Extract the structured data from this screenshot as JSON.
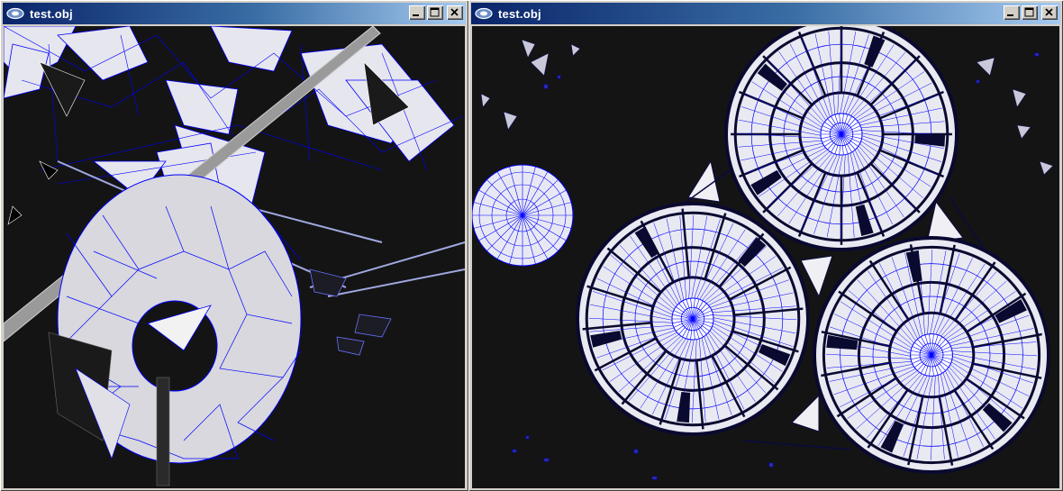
{
  "windows": [
    {
      "title": "test.obj",
      "icon": "obj-viewer-app-icon",
      "buttons": {
        "minimize": "minimize-icon",
        "maximize": "maximize-icon",
        "close": "close-icon"
      }
    },
    {
      "title": "test.obj",
      "icon": "obj-viewer-app-icon",
      "buttons": {
        "minimize": "minimize-icon",
        "maximize": "maximize-icon",
        "close": "close-icon"
      }
    }
  ],
  "colors": {
    "titlebar_start": "#0a246a",
    "titlebar_end": "#a6caf0",
    "viewport_bg": "#141414",
    "mesh_face": "#e8e8f0",
    "wireframe": "#0000ff"
  }
}
